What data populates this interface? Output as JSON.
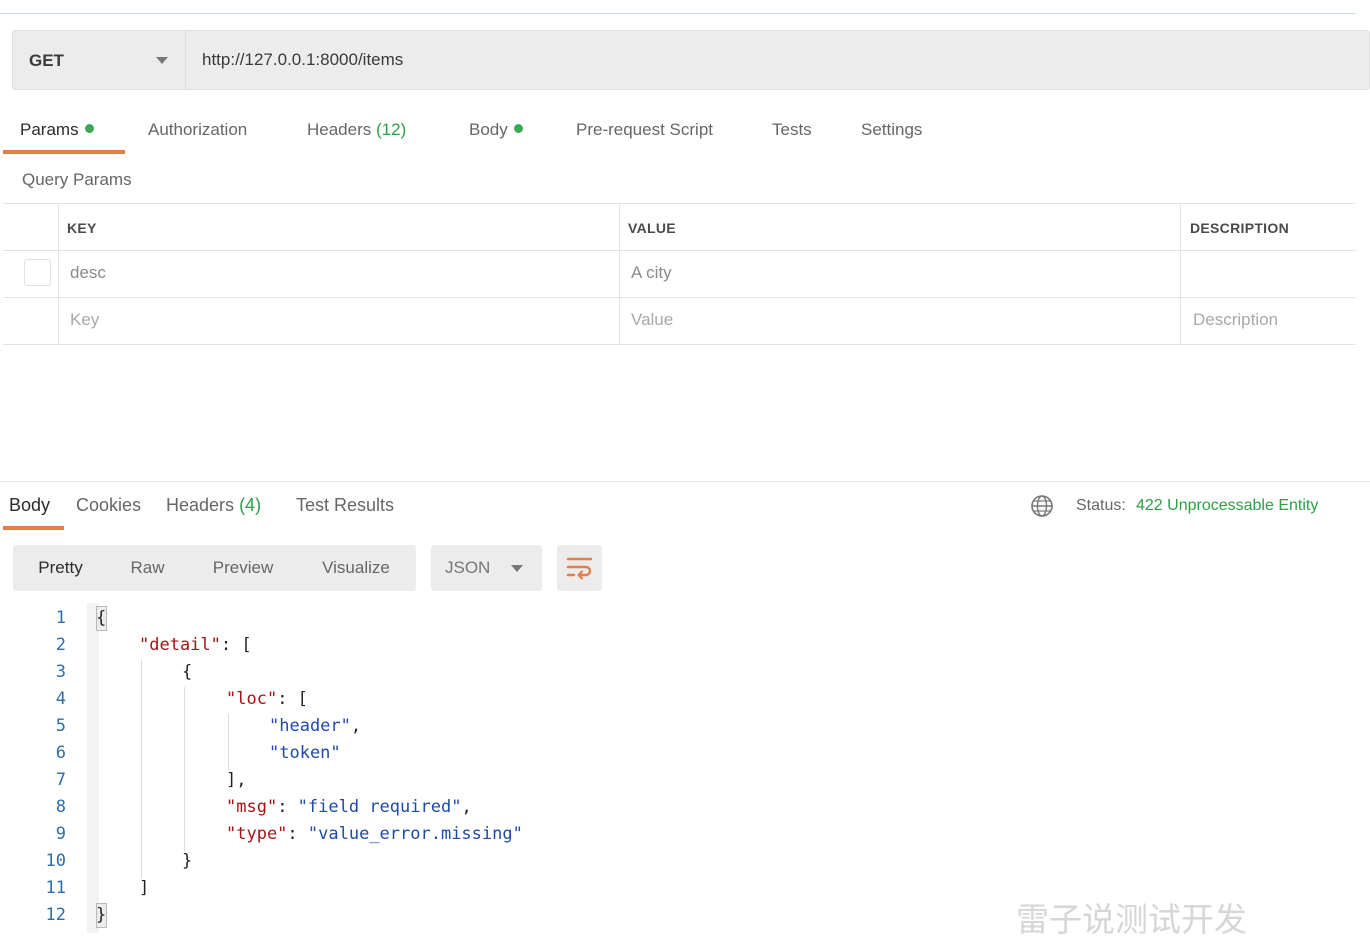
{
  "request": {
    "method": "GET",
    "url": "http://127.0.0.1:8000/items"
  },
  "request_tabs": {
    "params": "Params",
    "authorization": "Authorization",
    "headers": "Headers",
    "headers_count": "(12)",
    "body": "Body",
    "prerequest": "Pre-request Script",
    "tests": "Tests",
    "settings": "Settings"
  },
  "query_params": {
    "title": "Query Params",
    "columns": {
      "key": "KEY",
      "value": "VALUE",
      "description": "DESCRIPTION"
    },
    "rows": [
      {
        "key": "desc",
        "value": "A city",
        "description": ""
      }
    ],
    "placeholders": {
      "key": "Key",
      "value": "Value",
      "description": "Description"
    }
  },
  "response_tabs": {
    "body": "Body",
    "cookies": "Cookies",
    "headers": "Headers",
    "headers_count": "(4)",
    "test_results": "Test Results"
  },
  "status": {
    "label": "Status:",
    "value": "422 Unprocessable Entity",
    "value_color": "#2f9e44"
  },
  "view_modes": {
    "pretty": "Pretty",
    "raw": "Raw",
    "preview": "Preview",
    "visualize": "Visualize"
  },
  "format": "JSON",
  "icons": {
    "method_dropdown": "chevron-down-icon",
    "globe": "globe-icon",
    "format_dropdown": "chevron-down-icon",
    "wrap": "wrap-lines-icon"
  },
  "accent_color": "#e67e4a",
  "code_lines": [
    {
      "n": "1",
      "text": "{"
    },
    {
      "n": "2",
      "text": "\"detail\": ["
    },
    {
      "n": "3",
      "text": "{"
    },
    {
      "n": "4",
      "text": "\"loc\": ["
    },
    {
      "n": "5",
      "text": "\"header\","
    },
    {
      "n": "6",
      "text": "\"token\""
    },
    {
      "n": "7",
      "text": "],"
    },
    {
      "n": "8",
      "text": "\"msg\": \"field required\","
    },
    {
      "n": "9",
      "text": "\"type\": \"value_error.missing\""
    },
    {
      "n": "10",
      "text": "}"
    },
    {
      "n": "11",
      "text": "]"
    },
    {
      "n": "12",
      "text": "}"
    }
  ],
  "watermark": "雷子说测试开发"
}
